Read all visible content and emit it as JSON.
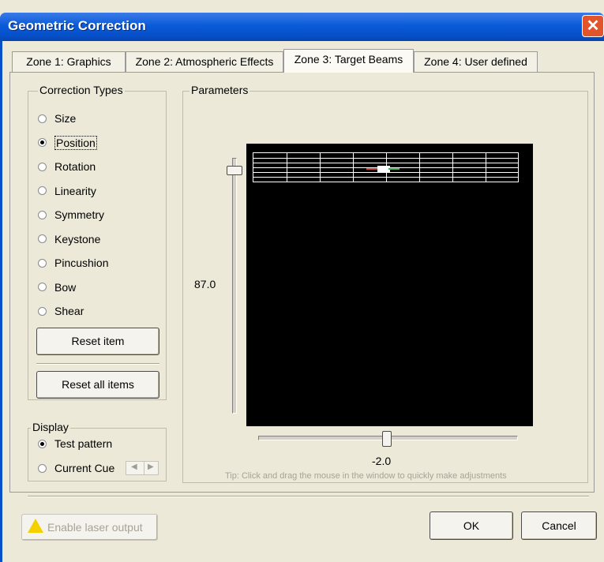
{
  "window": {
    "title": "Geometric Correction",
    "close_glyph": "✕"
  },
  "tabs": [
    {
      "label": "Zone 1: Graphics",
      "active": false
    },
    {
      "label": "Zone 2: Atmospheric Effects",
      "active": false
    },
    {
      "label": "Zone 3: Target Beams",
      "active": true
    },
    {
      "label": "Zone 4: User defined",
      "active": false
    }
  ],
  "correction_types": {
    "label": "Correction Types",
    "options": [
      "Size",
      "Position",
      "Rotation",
      "Linearity",
      "Symmetry",
      "Keystone",
      "Pincushion",
      "Bow",
      "Shear"
    ],
    "selected": "Position",
    "reset_item": "Reset item",
    "reset_all": "Reset all items"
  },
  "display": {
    "label": "Display",
    "options": [
      "Test pattern",
      "Current Cue"
    ],
    "selected": "Test pattern"
  },
  "parameters": {
    "label": "Parameters",
    "vertical_value": "87.0",
    "horizontal_value": "-2.0",
    "vertical_level": 0.1,
    "horizontal_level": 0.48,
    "tip": "Tip: Click and drag the mouse in the window to quickly make adjustments"
  },
  "footer": {
    "enable_laser": "Enable laser output",
    "ok": "OK",
    "cancel": "Cancel"
  },
  "colors": {
    "title_bar": "#0650c9",
    "dialog_bg": "#ece9d8",
    "viewport": "#000000"
  }
}
